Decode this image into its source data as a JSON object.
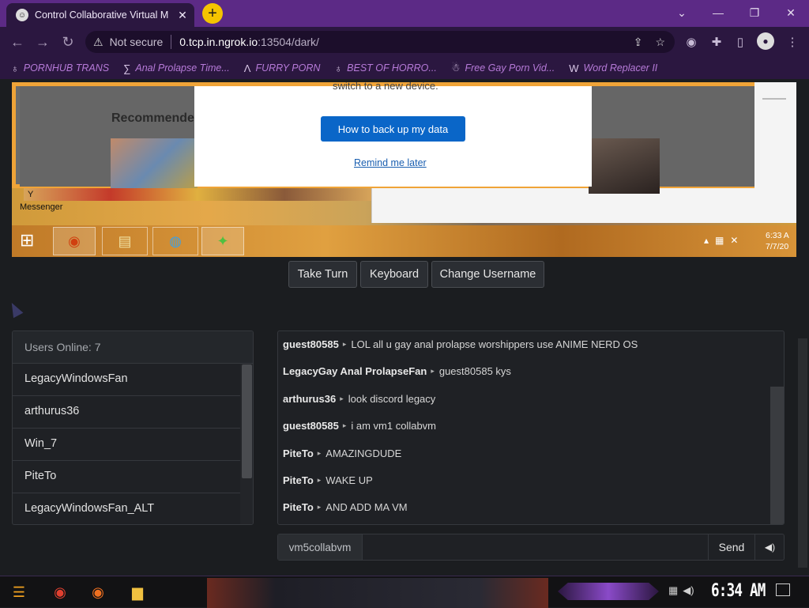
{
  "browser": {
    "tab_title": "Control Collaborative Virtual M",
    "tab_close": "✕",
    "new_tab": "+",
    "window_controls": {
      "dropdown": "⌄",
      "minimize": "—",
      "restore": "❐",
      "close": "✕"
    },
    "nav": {
      "back": "←",
      "forward": "→",
      "reload": "↻"
    },
    "address": {
      "security_icon": "warning-triangle-icon",
      "security_label": "Not secure",
      "host": "0.tcp.in.ngrok.io",
      "path": ":13504/dark/"
    },
    "bookmarks": [
      {
        "icon": "♁",
        "label": "PORNHUB TRANS"
      },
      {
        "icon": "∑",
        "label": "Anal Prolapse Time..."
      },
      {
        "icon": "Λ",
        "label": "FURRY PORN"
      },
      {
        "icon": "♁",
        "label": "BEST OF HORRO..."
      },
      {
        "icon": "☃",
        "label": "Free Gay Porn Vid..."
      },
      {
        "icon": "W",
        "label": "Word Replacer II"
      }
    ]
  },
  "vm": {
    "recommended_label": "Recommende",
    "dialog_partial_text": "switch to a new device.",
    "dialog_button": "How to back up my data",
    "dialog_link": "Remind me later",
    "messenger_label": "Messenger",
    "clock_time": "6:33 A",
    "clock_date": "7/7/20"
  },
  "controls": {
    "take_turn": "Take Turn",
    "keyboard": "Keyboard",
    "change_username": "Change Username"
  },
  "users": {
    "header": "Users Online: 7",
    "list": [
      "LegacyWindowsFan",
      "arthurus36",
      "Win_7",
      "PiteTo",
      "LegacyWindowsFan_ALT"
    ]
  },
  "chat": {
    "messages": [
      {
        "user": "guest80585",
        "text": "LOL all u gay anal prolapse worshippers use ANIME NERD OS"
      },
      {
        "user": "LegacyGay Anal ProlapseFan",
        "text": "guest80585 kys"
      },
      {
        "user": "arthurus36",
        "text": "look discord legacy"
      },
      {
        "user": "guest80585",
        "text": "i am vm1 collabvm"
      },
      {
        "user": "PiteTo",
        "text": "AMAZINGDUDE"
      },
      {
        "user": "PiteTo",
        "text": "WAKE UP"
      },
      {
        "user": "PiteTo",
        "text": "AND ADD MA VM"
      }
    ],
    "username": "vm5collabvm",
    "input_value": "",
    "send_label": "Send",
    "sound_icon": "speaker-icon"
  },
  "host_taskbar": {
    "clock": "6:34 AM"
  }
}
